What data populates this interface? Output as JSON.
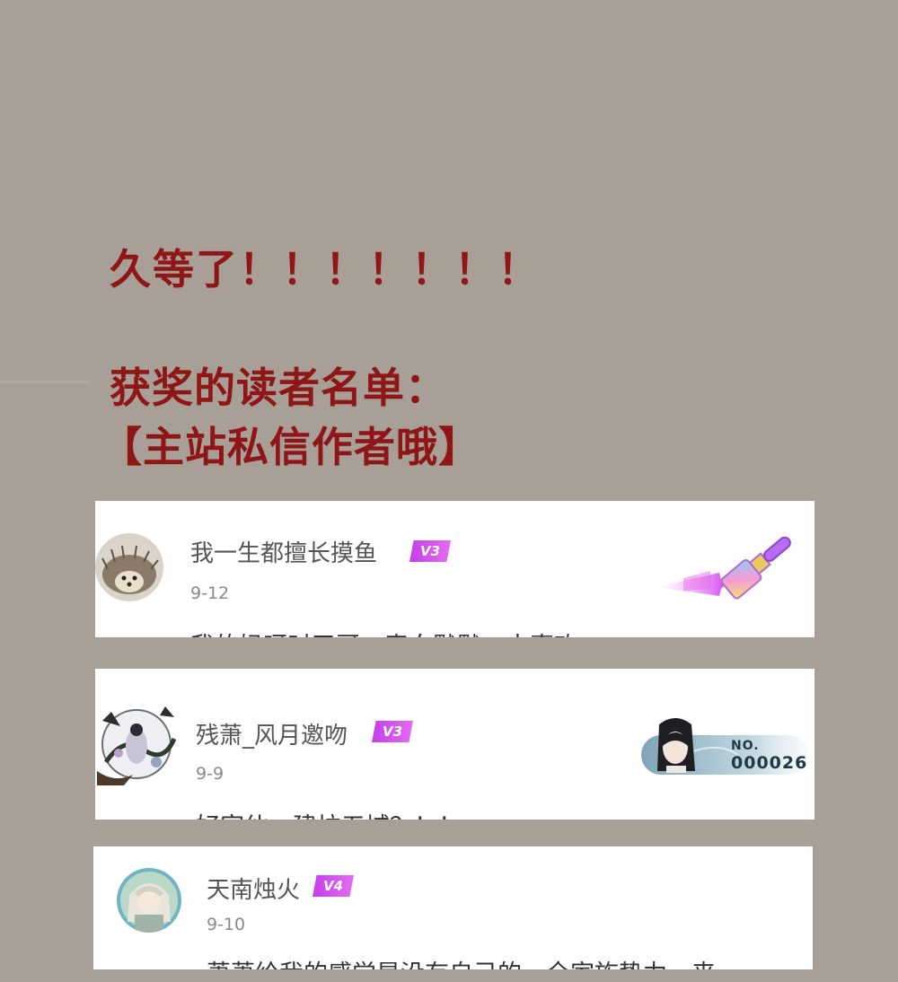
{
  "headlines": {
    "line1": "久等了！！！！！！！",
    "line2": "获奖的读者名单：",
    "line3": "【主站私信作者哦】"
  },
  "comments": [
    {
      "username": "我一生都擅长摸鱼",
      "level": "V3",
      "date": "9-12",
      "text": "我的妈呀时了哥，表白默默一人喜欢",
      "avatar_icon": "hedgehog-avatar-icon",
      "decoration_icon": "paintbrush-decoration-icon"
    },
    {
      "username": "残萧_风月邀吻",
      "level": "V3",
      "date": "9-9",
      "text": "好家伙，建垃五城？！！",
      "avatar_icon": "ink-painting-avatar-icon",
      "decoration_icon": "character-number-card-icon",
      "number_card": {
        "prefix": "NO.",
        "number": "000026"
      }
    },
    {
      "username": "天南烛火",
      "level": "V4",
      "date": "9-10",
      "text": "萧萧给我的感觉是没有自己的，全家族势力，来",
      "avatar_icon": "anime-character-avatar-icon"
    }
  ],
  "colors": {
    "background": "#a89f97",
    "headline": "#8e1616",
    "badge": "#d053ef"
  }
}
